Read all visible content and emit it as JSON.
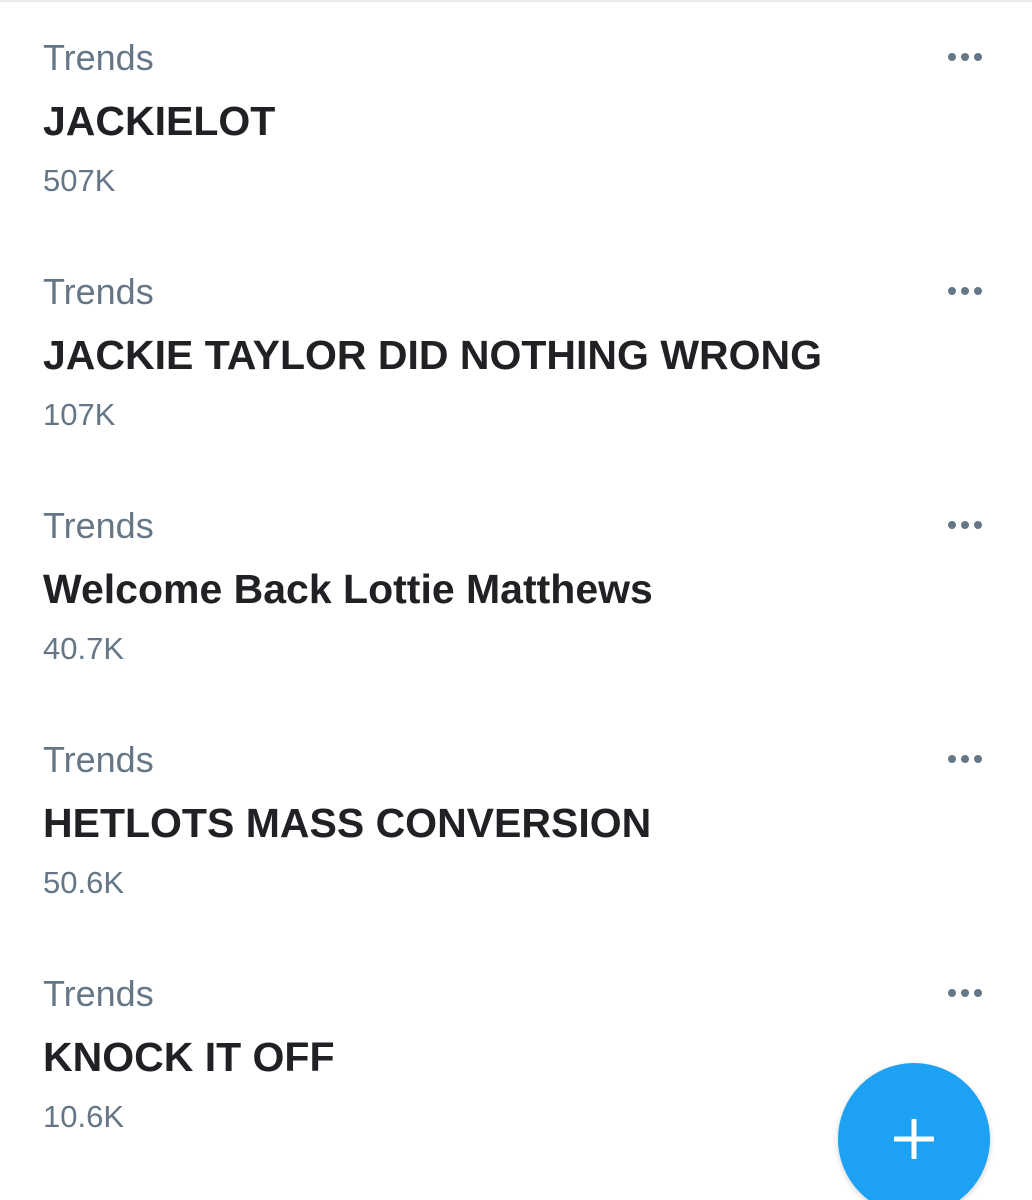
{
  "trends": [
    {
      "context": "Trends",
      "name": "JACKIELOT",
      "count": "507K",
      "more_icon": "more-horizontal-icon"
    },
    {
      "context": "Trends",
      "name": "JACKIE TAYLOR DID NOTHING WRONG",
      "count": "107K",
      "more_icon": "more-horizontal-icon"
    },
    {
      "context": "Trends",
      "name": "Welcome Back Lottie Matthews",
      "count": "40.7K",
      "more_icon": "more-horizontal-icon"
    },
    {
      "context": "Trends",
      "name": "HETLOTS MASS CONVERSION",
      "count": "50.6K",
      "more_icon": "more-horizontal-icon"
    },
    {
      "context": "Trends",
      "name": "KNOCK IT OFF",
      "count": "10.6K",
      "more_icon": "more-horizontal-icon"
    }
  ],
  "fab": {
    "icon": "plus-icon",
    "color": "#1da1f2"
  },
  "colors": {
    "context_text": "#657786",
    "name_text": "#202124",
    "accent": "#1da1f2"
  }
}
